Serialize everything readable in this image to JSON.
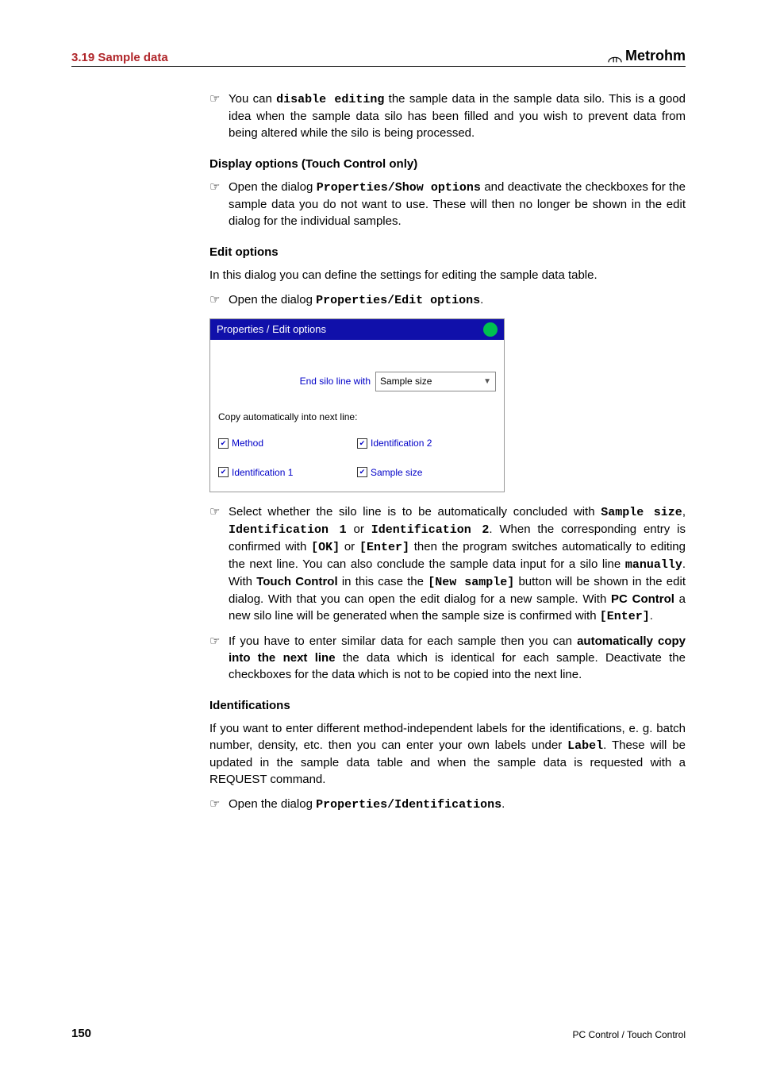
{
  "header": {
    "section": "3.19 Sample data",
    "brand": "Metrohm"
  },
  "p1": {
    "pre": "You can ",
    "bold1": "disable editing",
    "post": " the sample data in the sample data silo. This is a good idea when the sample data silo has been filled and you wish to prevent data from being altered while the silo is being processed."
  },
  "h_display": "Display options (Touch Control only)",
  "p2": {
    "pre": "Open the dialog ",
    "bold1": "Properties/Show options",
    "post": " and deactivate the checkboxes for the sample data you do not want to use. These will then no longer be shown in the edit dialog for the individual samples."
  },
  "h_edit": "Edit options",
  "p3": "In this dialog you can define the settings for editing the sample data table.",
  "p4": {
    "pre": "Open the dialog ",
    "bold1": "Properties/Edit options",
    "post": "."
  },
  "screenshot": {
    "title": "Properties / Edit options",
    "end_silo_label": "End silo line with",
    "end_silo_value": "Sample size",
    "copy_label": "Copy automatically into next line:",
    "checks": {
      "method": "Method",
      "id2": "Identification 2",
      "id1": "Identification 1",
      "size": "Sample size"
    }
  },
  "p5": {
    "t1": "Select whether the silo line is to be automatically concluded with ",
    "b1": "Sample size",
    "t2": ", ",
    "b2": "Identification 1",
    "t3": " or ",
    "b3": "Identification 2",
    "t4": ". When the corresponding entry is confirmed with ",
    "b4": "[OK]",
    "t5": " or ",
    "b5": "[Enter]",
    "t6": " then the program switches automatically to editing the next line. You can also conclude the sample data input for a silo line ",
    "b6": "manually",
    "t7": ". With ",
    "b7": "Touch Control",
    "t8": " in this case the ",
    "b8": "[New sample]",
    "t9": " button will be shown in the edit dialog. With that you can open the edit dialog for a new sample. With ",
    "b9": "PC Control",
    "t10": " a new silo line will be generated when the sample size is confirmed with ",
    "b10": "[Enter]",
    "t11": "."
  },
  "p6": {
    "t1": "If you have to enter similar data for each sample then you can ",
    "b1": "automatically copy into the next line",
    "t2": " the data which is identical for each sample. Deactivate the checkboxes for the data which is not to be copied into the next line."
  },
  "h_ident": "Identifications",
  "p7": {
    "t1": "If you want to enter different method-independent labels for the identifications, e. g. batch number, density, etc. then you can enter your own labels under ",
    "b1": "Label",
    "t2": ". These will be updated in the sample data table and when the sample data is requested with a REQUEST command."
  },
  "p8": {
    "pre": "Open the dialog ",
    "bold1": "Properties/Identifications",
    "post": "."
  },
  "footer": {
    "page": "150",
    "right": "PC Control / Touch Control"
  }
}
